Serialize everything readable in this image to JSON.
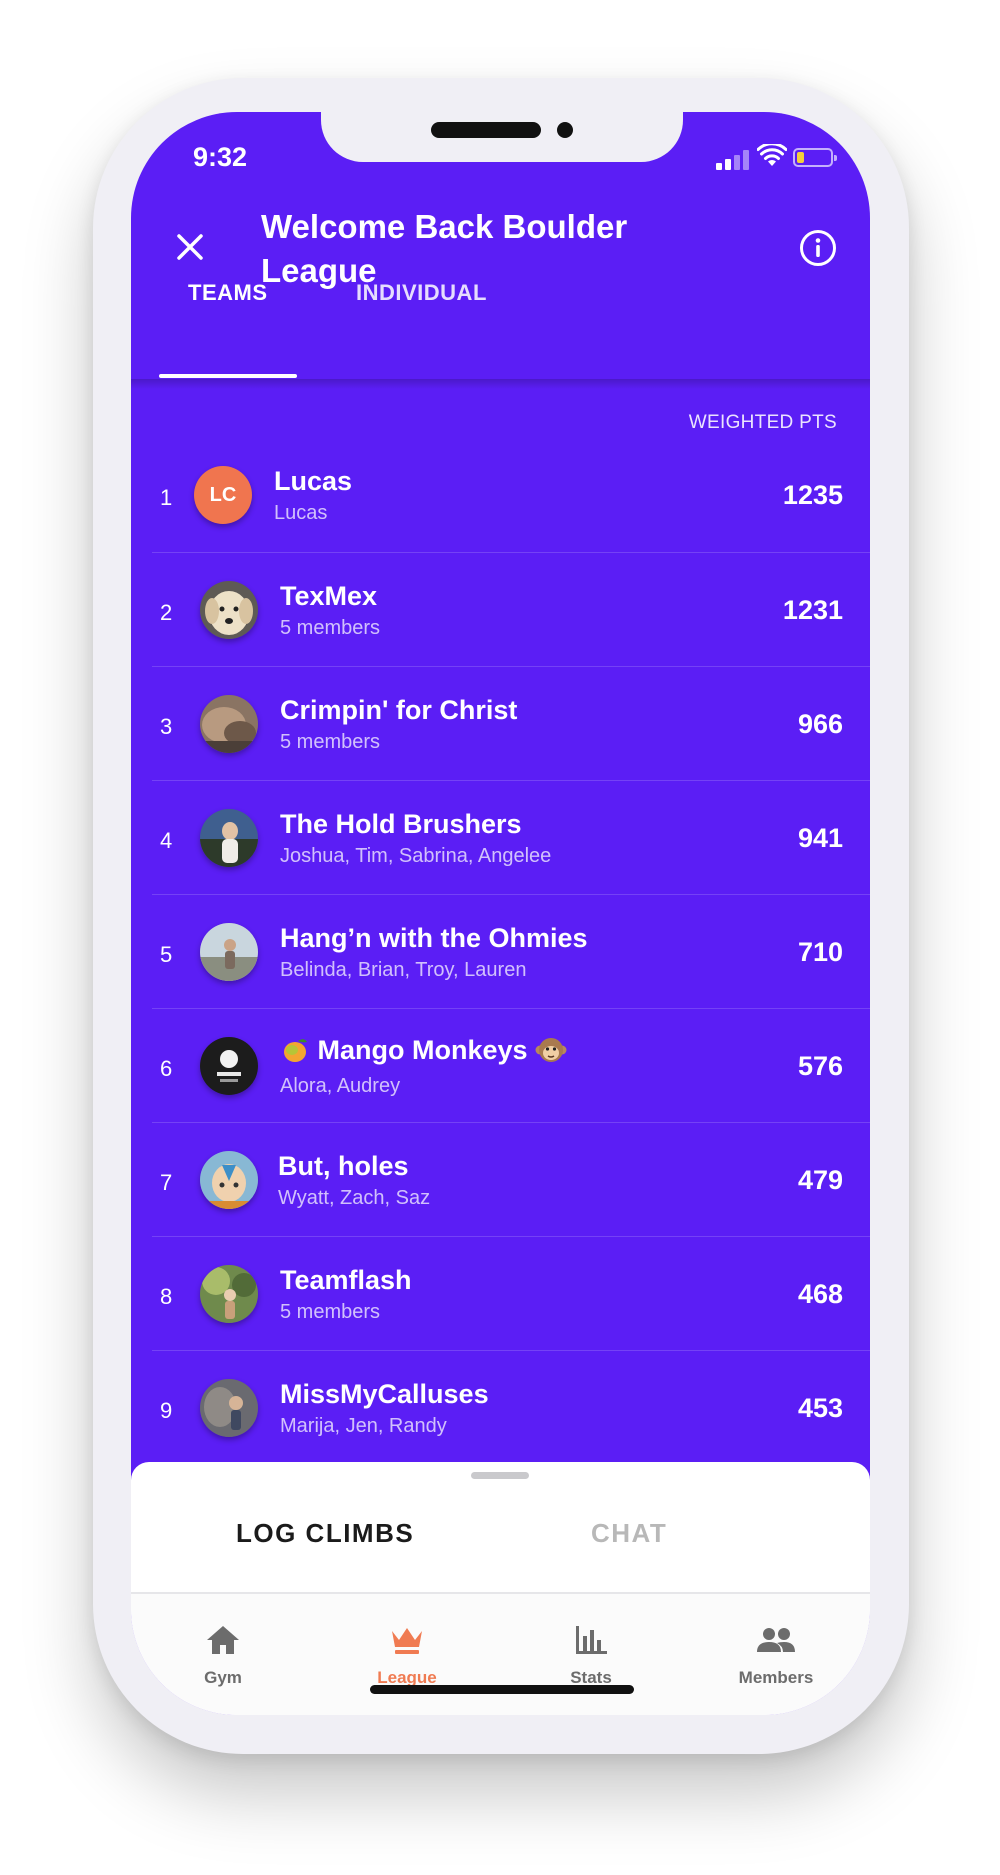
{
  "status_bar": {
    "time": "9:32"
  },
  "header": {
    "title": "Welcome Back Boulder League"
  },
  "tabs": [
    {
      "label": "TEAMS",
      "active": true
    },
    {
      "label": "INDIVIDUAL",
      "active": false
    }
  ],
  "leaderboard": {
    "column_header": "WEIGHTED PTS",
    "rows": [
      {
        "rank": "1",
        "name": "Lucas",
        "subtitle": "Lucas",
        "points": "1235",
        "avatar_initials": "LC"
      },
      {
        "rank": "2",
        "name": "TexMex",
        "subtitle": "5 members",
        "points": "1231",
        "avatar": "dog-photo"
      },
      {
        "rank": "3",
        "name": "Crimpin' for Christ",
        "subtitle": "5 members",
        "points": "966",
        "avatar": "rock-photo"
      },
      {
        "rank": "4",
        "name": "The Hold Brushers",
        "subtitle": "Joshua, Tim, Sabrina, Angelee",
        "points": "941",
        "avatar": "person-photo"
      },
      {
        "rank": "5",
        "name": "Hang’n with the Ohmies",
        "subtitle": "Belinda, Brian, Troy, Lauren",
        "points": "710",
        "avatar": "outdoor-photo"
      },
      {
        "rank": "6",
        "name": "Mango Monkeys",
        "subtitle": "Alora, Audrey",
        "points": "576",
        "avatar": "logo-badge",
        "name_prefix_emoji": "mango",
        "name_suffix_emoji": "monkey"
      },
      {
        "rank": "7",
        "name": "But, holes",
        "subtitle": "Wyatt, Zach, Saz",
        "points": "479",
        "avatar": "cartoon-avatar"
      },
      {
        "rank": "8",
        "name": "Teamflash",
        "subtitle": "5 members",
        "points": "468",
        "avatar": "tree-photo"
      },
      {
        "rank": "9",
        "name": "MissMyCalluses",
        "subtitle": "Marija, Jen, Randy",
        "points": "453",
        "avatar": "climber-photo"
      }
    ]
  },
  "bottom_sheet": {
    "log_label": "LOG CLIMBS",
    "chat_label": "CHAT"
  },
  "tab_bar": [
    {
      "label": "Gym",
      "icon": "home-icon",
      "active": false
    },
    {
      "label": "League",
      "icon": "crown-icon",
      "active": true
    },
    {
      "label": "Stats",
      "icon": "bar-chart-icon",
      "active": false
    },
    {
      "label": "Members",
      "icon": "people-icon",
      "active": false
    }
  ],
  "colors": {
    "primary": "#5b1ef5",
    "accent": "#f07b52",
    "initials_bg": "#f0754f"
  }
}
